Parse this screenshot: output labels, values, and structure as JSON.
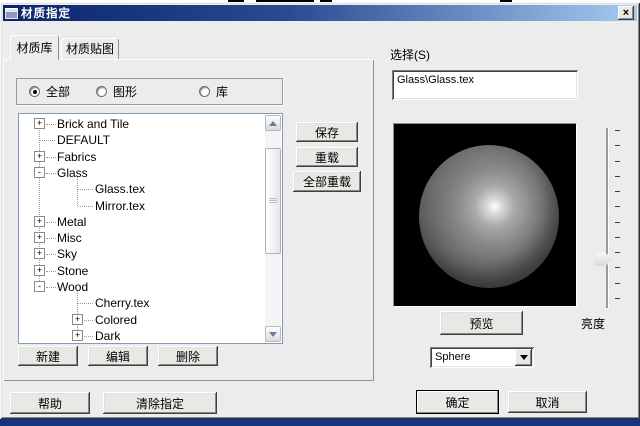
{
  "window": {
    "title": "材质指定",
    "close_glyph": "×"
  },
  "tabs": {
    "library": "材质库",
    "map": "材质贴图"
  },
  "filters": {
    "all": "全部",
    "graphic": "图形",
    "library": "库",
    "selected": "全部"
  },
  "tree": {
    "items": [
      {
        "label": "Brick and Tile",
        "level": 0,
        "toggle": "+"
      },
      {
        "label": "DEFAULT",
        "level": 0,
        "toggle": ""
      },
      {
        "label": "Fabrics",
        "level": 0,
        "toggle": "+"
      },
      {
        "label": "Glass",
        "level": 0,
        "toggle": "-"
      },
      {
        "label": "Glass.tex",
        "level": 1,
        "toggle": ""
      },
      {
        "label": "Mirror.tex",
        "level": 1,
        "toggle": ""
      },
      {
        "label": "Metal",
        "level": 0,
        "toggle": "+"
      },
      {
        "label": "Misc",
        "level": 0,
        "toggle": "+"
      },
      {
        "label": "Sky",
        "level": 0,
        "toggle": "+"
      },
      {
        "label": "Stone",
        "level": 0,
        "toggle": "+"
      },
      {
        "label": "Wood",
        "level": 0,
        "toggle": "-"
      },
      {
        "label": "Cherry.tex",
        "level": 1,
        "toggle": ""
      },
      {
        "label": "Colored",
        "level": 1,
        "toggle": "+"
      },
      {
        "label": "Dark",
        "level": 1,
        "toggle": "+"
      }
    ]
  },
  "library_buttons": {
    "new": "新建",
    "edit": "编辑",
    "delete": "删除"
  },
  "side_buttons": {
    "save": "保存",
    "reload": "重载",
    "reload_all": "全部重载"
  },
  "selection": {
    "label": "选择(S)",
    "value": "Glass\\Glass.tex"
  },
  "preview": {
    "button": "预览",
    "brightness_label": "亮度",
    "shape_value": "Sphere"
  },
  "footer": {
    "help": "帮助",
    "clear": "清除指定",
    "ok": "确定",
    "cancel": "取消"
  },
  "colors": {
    "titlebar_left": "#0a246a",
    "titlebar_right": "#a6caf0",
    "dialog_bg": "#ececec",
    "preview_bg": "#000000",
    "bottom_bar": "#16337f",
    "tree_border": "#7f9db9"
  }
}
